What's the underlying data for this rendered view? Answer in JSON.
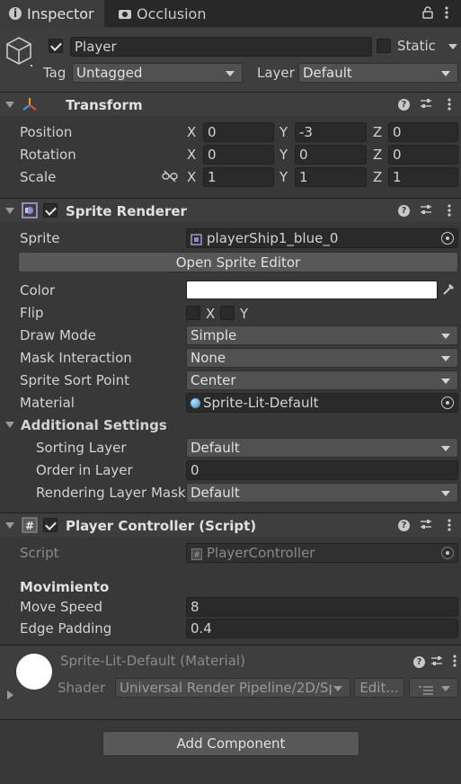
{
  "tabs": [
    {
      "label": "Inspector",
      "icon": "info-icon"
    },
    {
      "label": "Occlusion",
      "icon": "camera-icon"
    }
  ],
  "object": {
    "name": "Player",
    "active": true,
    "static_label": "Static",
    "tag_label": "Tag",
    "tag_value": "Untagged",
    "layer_label": "Layer",
    "layer_value": "Default"
  },
  "transform": {
    "title": "Transform",
    "rows": [
      {
        "label": "Position",
        "x": "0",
        "y": "-3",
        "z": "0"
      },
      {
        "label": "Rotation",
        "x": "0",
        "y": "0",
        "z": "0"
      },
      {
        "label": "Scale",
        "x": "1",
        "y": "1",
        "z": "1"
      }
    ],
    "axes": [
      "X",
      "Y",
      "Z"
    ]
  },
  "sprite_renderer": {
    "title": "Sprite Renderer",
    "enabled": true,
    "sprite_label": "Sprite",
    "sprite_value": "playerShip1_blue_0",
    "open_editor": "Open Sprite Editor",
    "color_label": "Color",
    "color_value": "#ffffff",
    "flip_label": "Flip",
    "flip_x": "X",
    "flip_y": "Y",
    "draw_mode_label": "Draw Mode",
    "draw_mode_value": "Simple",
    "mask_label": "Mask Interaction",
    "mask_value": "None",
    "sort_point_label": "Sprite Sort Point",
    "sort_point_value": "Center",
    "material_label": "Material",
    "material_value": "Sprite-Lit-Default",
    "additional_label": "Additional Settings",
    "sorting_layer_label": "Sorting Layer",
    "sorting_layer_value": "Default",
    "order_label": "Order in Layer",
    "order_value": "0",
    "rendering_mask_label": "Rendering Layer Mask",
    "rendering_mask_value": "Default"
  },
  "player_controller": {
    "title": "Player Controller (Script)",
    "enabled": true,
    "script_label": "Script",
    "script_value": "PlayerController",
    "section_header": "Movimiento",
    "move_speed_label": "Move Speed",
    "move_speed_value": "8",
    "edge_padding_label": "Edge Padding",
    "edge_padding_value": "0.4"
  },
  "material_panel": {
    "title": "Sprite-Lit-Default (Material)",
    "shader_label": "Shader",
    "shader_value": "Universal Render Pipeline/2D/Spri",
    "edit_label": "Edit..."
  },
  "add_component_label": "Add Component"
}
